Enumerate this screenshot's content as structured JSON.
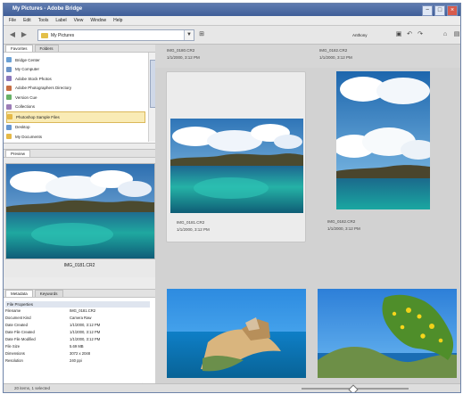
{
  "window": {
    "title": "My Pictures - Adobe Bridge"
  },
  "menu": [
    "File",
    "Edit",
    "Tools",
    "Label",
    "View",
    "Window",
    "Help"
  ],
  "toolbar": {
    "location": "My Pictures",
    "user": "Anthony"
  },
  "left_panel": {
    "tabs": [
      "Favorites",
      "Folders"
    ],
    "favorites": [
      {
        "label": "Bridge Center",
        "selected": false,
        "color": "#6aa0d5"
      },
      {
        "label": "My Computer",
        "selected": false,
        "color": "#6c95c9"
      },
      {
        "label": "Adobe Stock Photos",
        "selected": false,
        "color": "#8a77bc"
      },
      {
        "label": "Adobe Photographers Directory",
        "selected": false,
        "color": "#c76e44"
      },
      {
        "label": "Version Cue",
        "selected": false,
        "color": "#68b267"
      },
      {
        "label": "Collections",
        "selected": false,
        "color": "#9c7db7"
      },
      {
        "label": "Photoshop Sample Files",
        "selected": true,
        "color": "#e5b947"
      },
      {
        "label": "Desktop",
        "selected": false,
        "color": "#6797d0"
      },
      {
        "label": "My Documents",
        "selected": false,
        "color": "#e5b947"
      }
    ]
  },
  "preview": {
    "tab": "Preview",
    "caption": "IMG_0181.CR2"
  },
  "metadata": {
    "tabs": [
      "Metadata",
      "Keywords"
    ],
    "section": "File Properties",
    "rows": [
      {
        "k": "Filename",
        "v": "IMG_0181.CR2"
      },
      {
        "k": "Document Kind",
        "v": "Camera Raw"
      },
      {
        "k": "Date Created",
        "v": "1/1/2000, 3:12 PM"
      },
      {
        "k": "Date File Created",
        "v": "1/1/2000, 3:12 PM"
      },
      {
        "k": "Date File Modified",
        "v": "1/1/2000, 3:12 PM"
      },
      {
        "k": "File Size",
        "v": "5.69 MB"
      },
      {
        "k": "Dimensions",
        "v": "3072 x 2048"
      },
      {
        "k": "Resolution",
        "v": "240 ppi"
      }
    ]
  },
  "content": {
    "top_labels": [
      {
        "text": "IMG_0180.CR2"
      },
      {
        "text": "1/1/2000, 3:12 PM"
      },
      {
        "text": "IMG_0182.CR2"
      },
      {
        "text": "1/1/2000, 3:12 PM"
      }
    ],
    "tiles": [
      {
        "name": "IMG_0181.CR2",
        "date": "1/1/2000, 3:12 PM"
      },
      {
        "name": "IMG_0182.CR2",
        "date": "1/1/2000, 3:12 PM"
      }
    ]
  },
  "statusbar": {
    "text": "20 items, 1 selected"
  },
  "colors": {
    "title_blue": "#4e6fa8",
    "selection_yellow": "#f9ebb5"
  }
}
